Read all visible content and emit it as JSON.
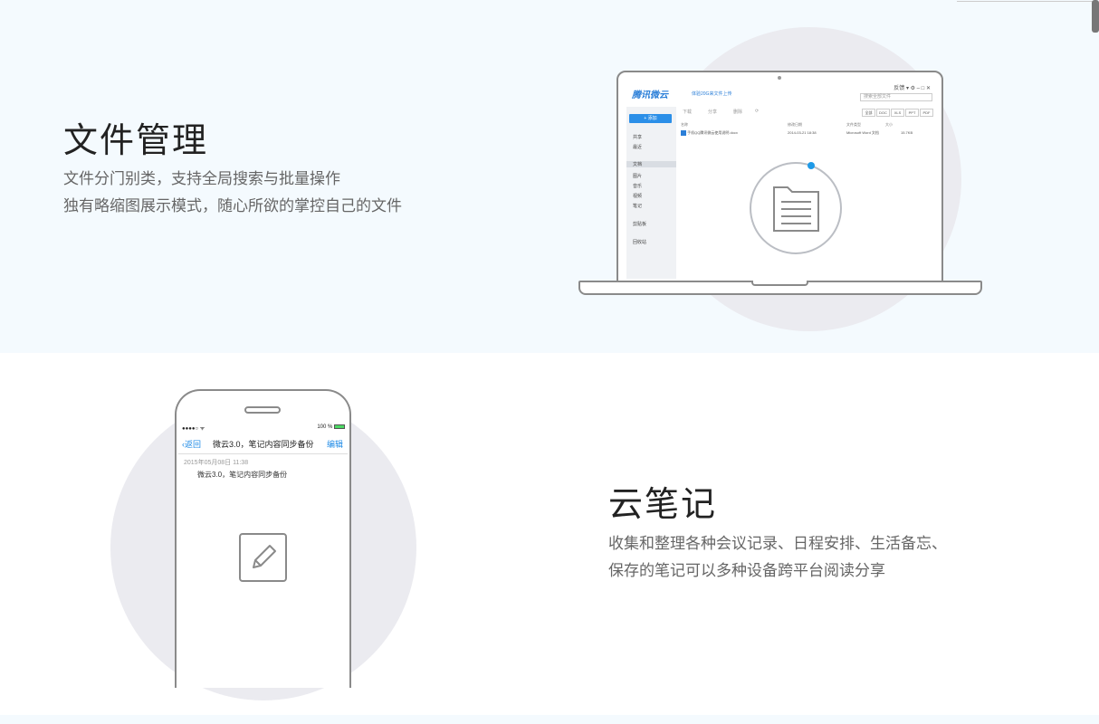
{
  "file_section": {
    "title": "文件管理",
    "desc_line1": "文件分门别类，支持全局搜索与批量操作",
    "desc_line2": "独有略缩图展示模式，随心所欲的掌控自己的文件"
  },
  "notes_section": {
    "title": "云笔记",
    "desc_line1": "收集和整理各种会议记录、日程安排、生活备忘、",
    "desc_line2": "保存的笔记可以多种设备跨平台阅读分享"
  },
  "laptop_app": {
    "logo": "腾讯微云",
    "promo": "体验20G来文件上传",
    "search_placeholder": "搜索全部文件",
    "window_controls": "反馈 ▾ ⚙ – □ ✕",
    "add_button": "+ 添加",
    "nav": [
      "共享",
      "最近",
      "文档",
      "图片",
      "音乐",
      "视频",
      "笔记",
      "剪贴板",
      "回收站"
    ],
    "toolbar": [
      "下载",
      "分享",
      "删除",
      "⟳"
    ],
    "filters": [
      "全部",
      "DOC",
      "XLS",
      "PPT",
      "PDF"
    ],
    "columns": [
      "名称",
      "修改日期",
      "文件类型",
      "大小"
    ],
    "file": {
      "name": "手机QQ腾讯微云使用说明.docx",
      "date": "2014-03-21 18:38",
      "type": "Microsoft Word 文档",
      "size": "15.7KB"
    }
  },
  "phone_app": {
    "status_left": "●●●●○ ᯤ",
    "status_right": "100 %",
    "back_label": "返回",
    "title": "微云3.0，笔记内容同步备份",
    "edit_label": "编辑",
    "note_date": "2015年05月08日 11:38",
    "note_body": "微云3.0，笔记内容同步备份"
  },
  "colors": {
    "accent_blue": "#1e8ae6",
    "section_bg": "#f4fafe",
    "circle_bg": "#ebebf0"
  }
}
